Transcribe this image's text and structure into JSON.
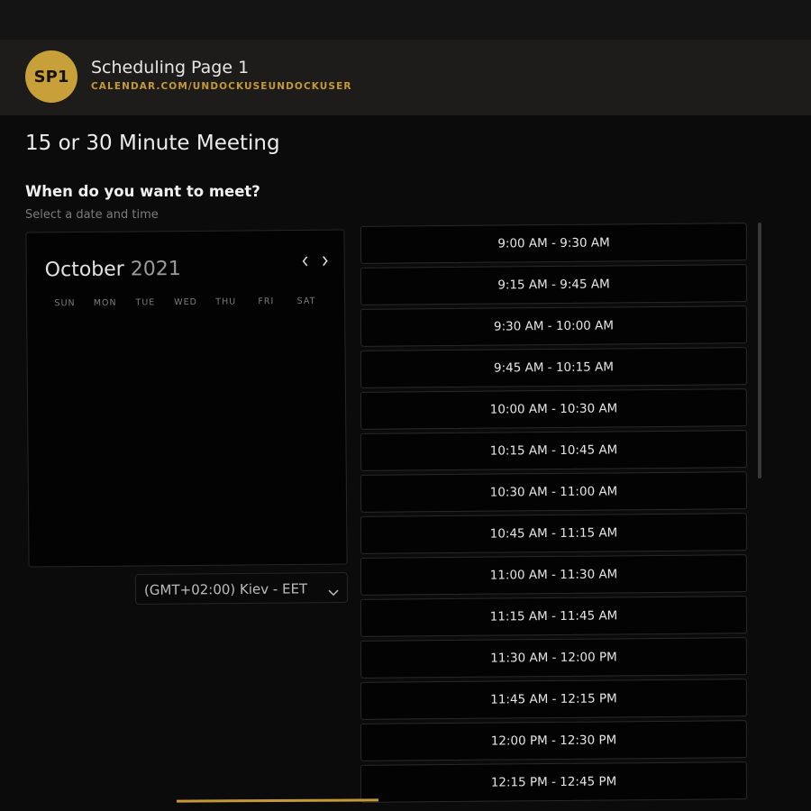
{
  "header": {
    "avatar_initials": "SP1",
    "page_name": "Scheduling Page 1",
    "page_url": "CALENDAR.COM/UNDOCKUSEUNDOCKUSER"
  },
  "main": {
    "meeting_title": "15 or 30 Minute Meeting",
    "question": "When do you want to meet?",
    "subtitle": "Select a date and time"
  },
  "calendar": {
    "month": "October",
    "year": "2021",
    "prev_icon": "chevron-left-icon",
    "next_icon": "chevron-right-icon",
    "weekdays": [
      "SUN",
      "MON",
      "TUE",
      "WED",
      "THU",
      "FRI",
      "SAT"
    ]
  },
  "timezone": {
    "selected": "(GMT+02:00) Kiev - EET",
    "icon": "chevron-down-icon"
  },
  "slots": [
    "9:00 AM - 9:30 AM",
    "9:15 AM - 9:45 AM",
    "9:30 AM - 10:00 AM",
    "9:45 AM - 10:15 AM",
    "10:00 AM - 10:30 AM",
    "10:15 AM - 10:45 AM",
    "10:30 AM - 11:00 AM",
    "10:45 AM - 11:15 AM",
    "11:00 AM - 11:30 AM",
    "11:15 AM - 11:45 AM",
    "11:30 AM - 12:00 PM",
    "11:45 AM - 12:15 PM",
    "12:00 PM - 12:30 PM",
    "12:15 PM - 12:45 PM"
  ],
  "colors": {
    "accent": "#c59a36",
    "background": "#0b0b0b",
    "header_background": "#1d1c1a"
  }
}
